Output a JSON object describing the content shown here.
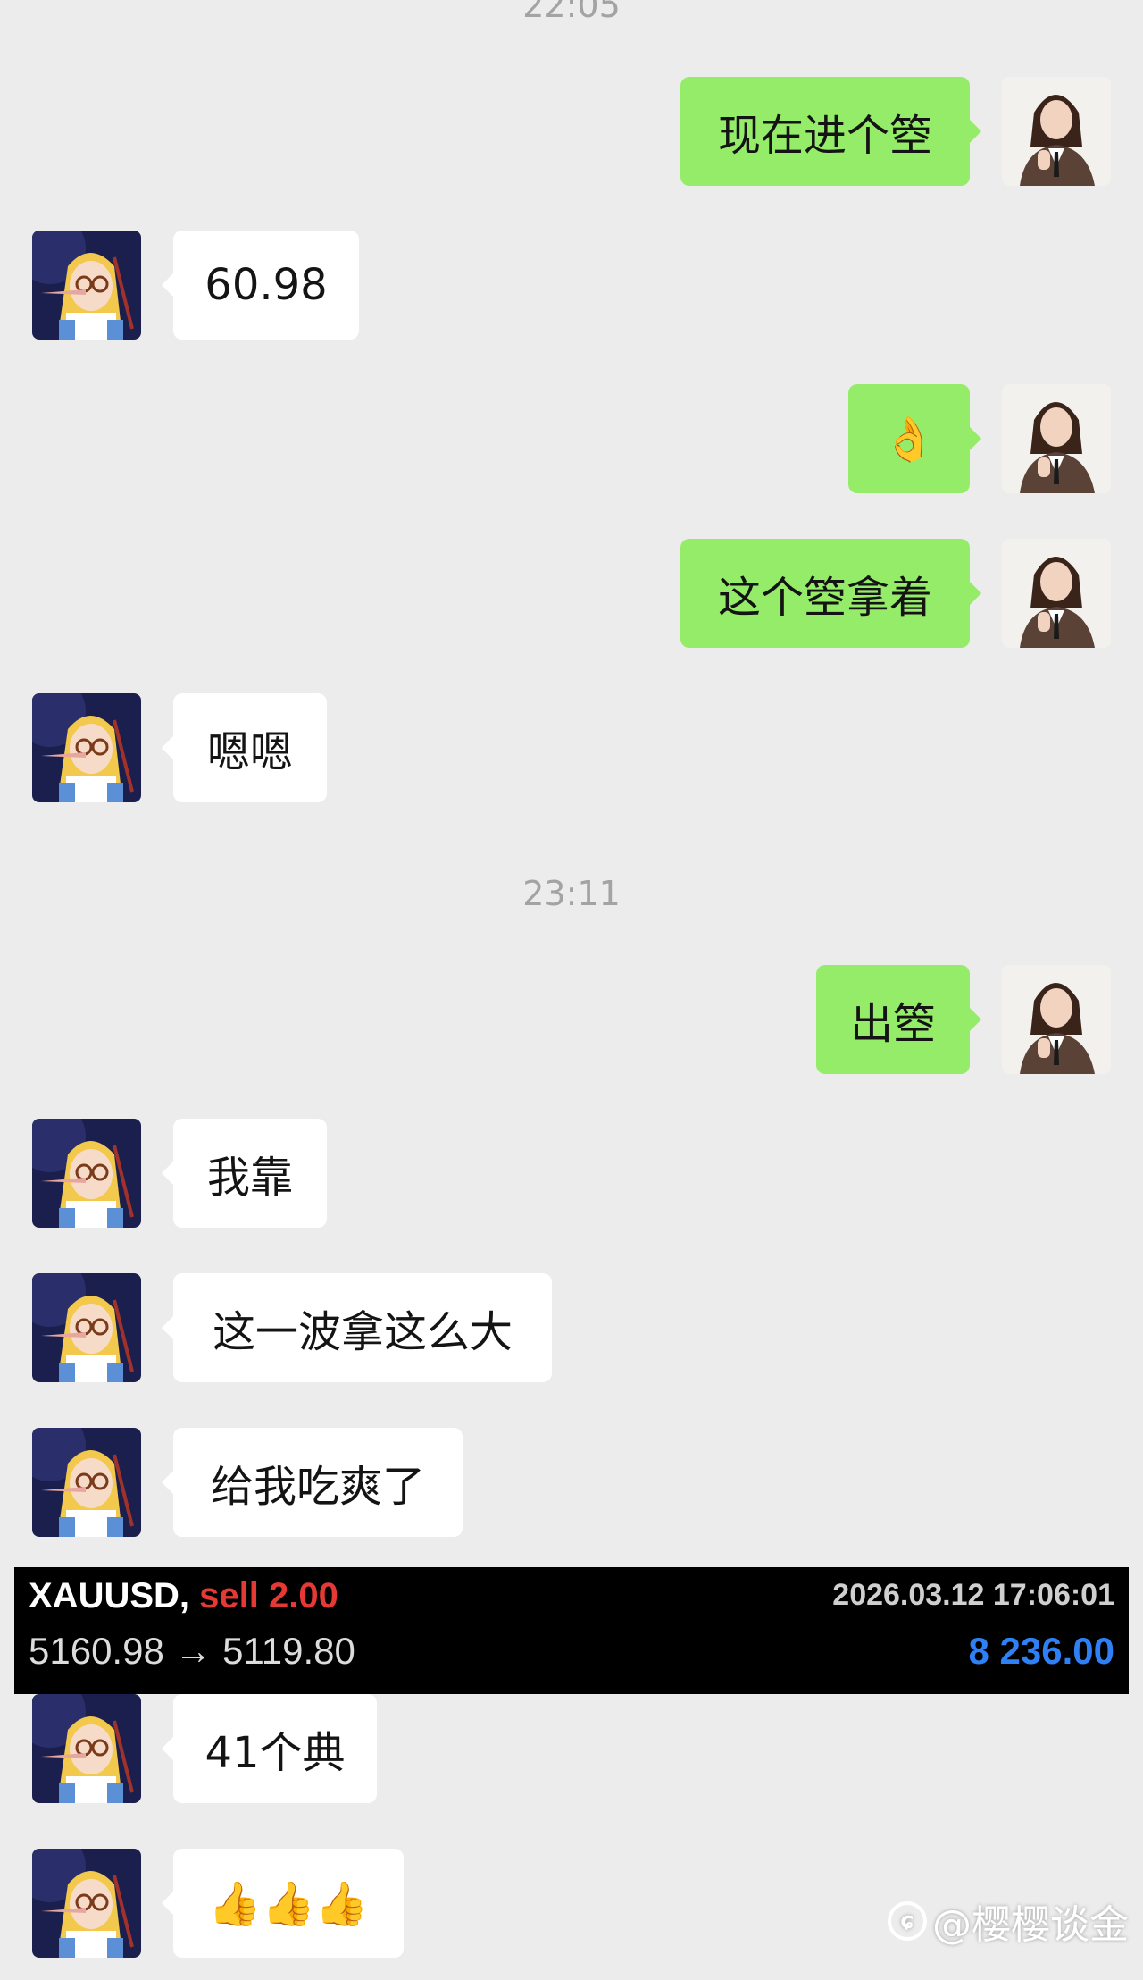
{
  "timestamps": [
    "22:05",
    "23:11"
  ],
  "messages": [
    {
      "side": "right",
      "text": "现在进个箜"
    },
    {
      "side": "left",
      "text": "60.98"
    },
    {
      "side": "right",
      "text": "👌"
    },
    {
      "side": "right",
      "text": "这个箜拿着"
    },
    {
      "side": "left",
      "text": "嗯嗯"
    },
    {
      "side": "right",
      "text": "出箜"
    },
    {
      "side": "left",
      "text": "我靠"
    },
    {
      "side": "left",
      "text": "这一波拿这么大"
    },
    {
      "side": "left",
      "text": "给我吃爽了"
    },
    {
      "side": "left",
      "text": "41个典"
    },
    {
      "side": "left",
      "text": "👍👍👍"
    }
  ],
  "trade": {
    "symbol": "XAUUSD,",
    "side": "sell 2.00",
    "datetime": "2026.03.12 17:06:01",
    "prices": "5160.98 → 5119.80",
    "profit": "8 236.00"
  },
  "watermark": {
    "icon": "weibo-icon",
    "text": "@樱樱谈金"
  },
  "colors": {
    "background": "#ececec",
    "sent_bubble": "#95ec69",
    "received_bubble": "#ffffff",
    "trade_sell": "#e53935",
    "trade_profit": "#2f7ff5"
  }
}
